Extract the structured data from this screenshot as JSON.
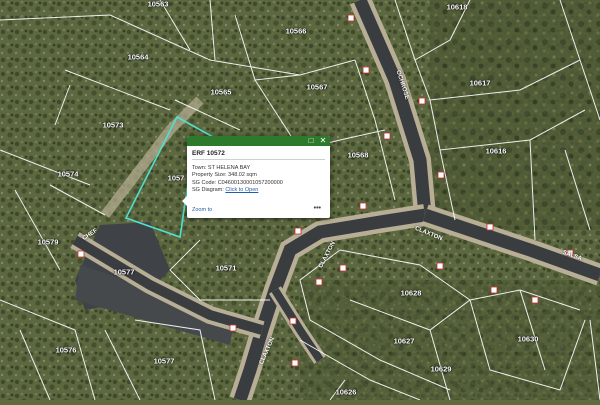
{
  "colors": {
    "aerial_base": "#5f6a3f",
    "parcel_line": "#ffffff",
    "road_surface": "#3a3d40",
    "road_verge": "#b7ae95",
    "selection": "#4fe0d0",
    "popup_header": "#2d7a2d",
    "link": "#1f5fa8"
  },
  "parcels": [
    {
      "label": "10563"
    },
    {
      "label": "10566"
    },
    {
      "label": "10564"
    },
    {
      "label": "10565"
    },
    {
      "label": "10567"
    },
    {
      "label": "10573"
    },
    {
      "label": "10574"
    },
    {
      "label": "10568"
    },
    {
      "label": "10579"
    },
    {
      "label": "10577"
    },
    {
      "label": "10571"
    },
    {
      "label": "10576"
    },
    {
      "label": "10577"
    },
    {
      "label": "10618"
    },
    {
      "label": "10617"
    },
    {
      "label": "10616"
    },
    {
      "label": "10628"
    },
    {
      "label": "10627"
    },
    {
      "label": "10630"
    },
    {
      "label": "10629"
    },
    {
      "label": "10626"
    },
    {
      "label": "1057"
    }
  ],
  "streets": [
    {
      "label": "CHEF"
    },
    {
      "label": "CLAXTON"
    },
    {
      "label": "CLAXTON"
    },
    {
      "label": "CLAXTON"
    },
    {
      "label": "OCHROSE"
    },
    {
      "label": "SALSA"
    }
  ],
  "popup": {
    "title": "ERF 10572",
    "icons": {
      "maximize": "maximize-icon",
      "close": "close-icon"
    },
    "town_label": "Town:",
    "town_value": "ST HELENA BAY",
    "size_label": "Property Size:",
    "size_value": "348.02 sqm",
    "sg_code_label": "SG Code:",
    "sg_code_value": "C04600130001057200000",
    "sg_diagram_label": "SG Diagram:",
    "sg_diagram_link": "Click to Open",
    "zoom_label": "Zoom to",
    "more_label": "•••"
  }
}
